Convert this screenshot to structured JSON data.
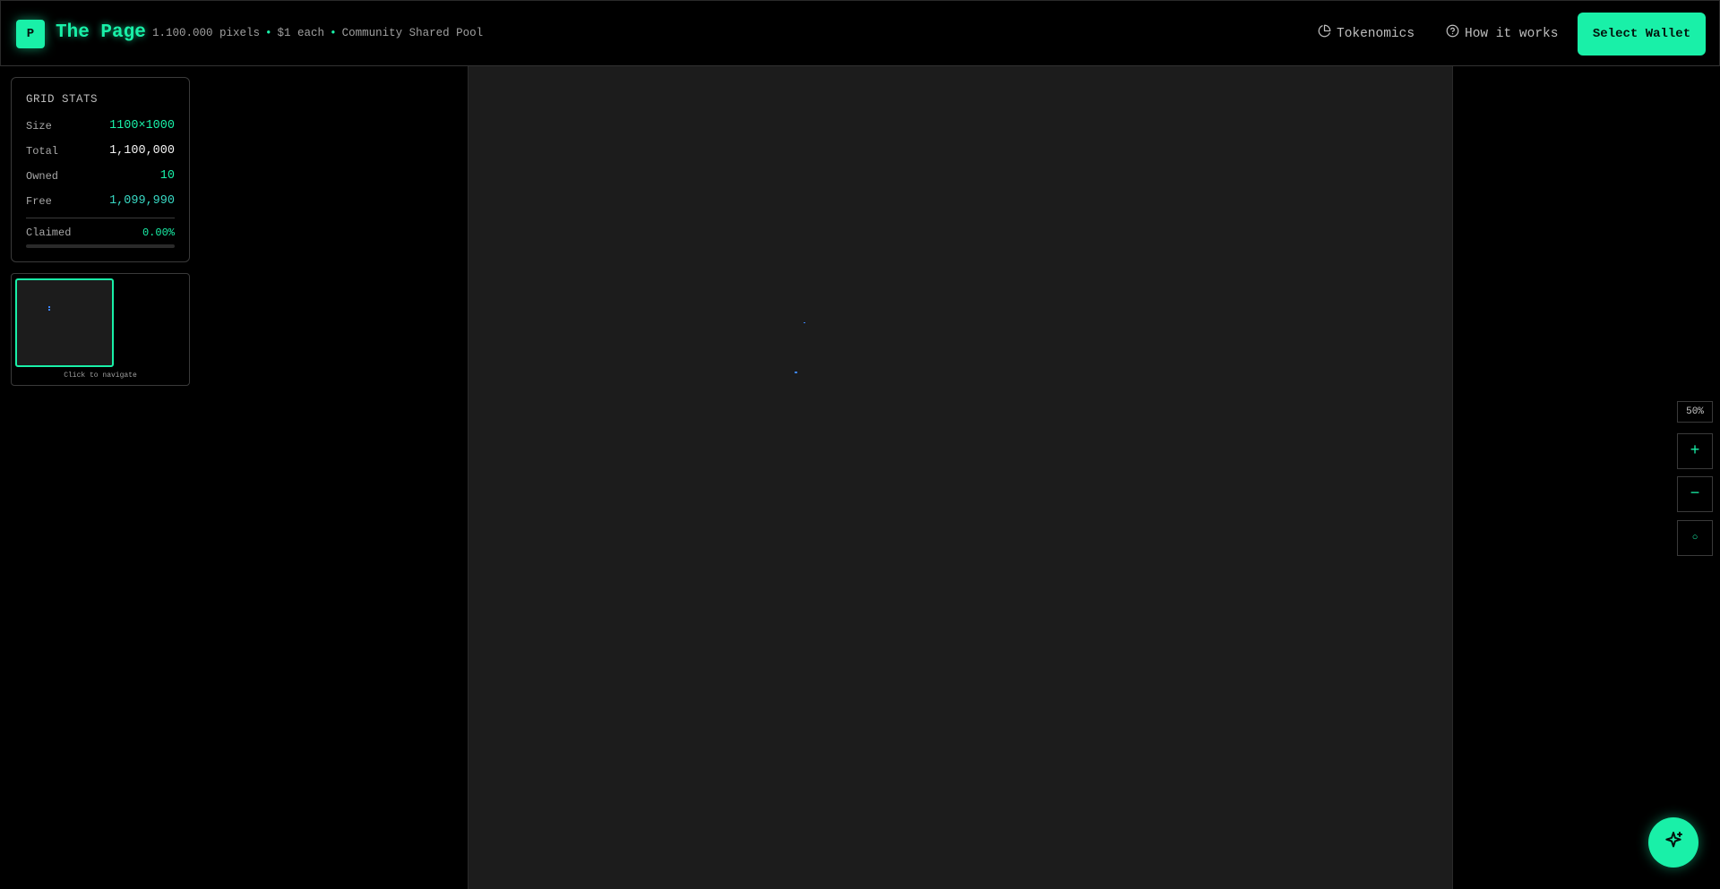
{
  "header": {
    "logo_letter": "P",
    "title": "The Page",
    "tagline_parts": [
      "1.100.000 pixels",
      "$1 each",
      "Community Shared Pool"
    ],
    "tagline_separator": "•",
    "nav": {
      "tokenomics": "Tokenomics",
      "how_it_works": "How it works"
    },
    "wallet_button": "Select Wallet"
  },
  "stats": {
    "title": "GRID STATS",
    "rows": [
      {
        "label": "Size",
        "value": "1100×1000"
      },
      {
        "label": "Total",
        "value": "1,100,000"
      },
      {
        "label": "Owned",
        "value": "10"
      },
      {
        "label": "Free",
        "value": "1,099,990"
      }
    ],
    "claimed_label": "Claimed",
    "claimed_value": "0.00%",
    "claimed_fraction": 0.0
  },
  "minimap": {
    "caption": "Click to navigate"
  },
  "zoom": {
    "level": "50%",
    "in_label": "+",
    "out_label": "−",
    "reset_label": "○"
  },
  "colors": {
    "accent": "#19f0a8",
    "background": "#000000",
    "canvas": "#1c1c1c",
    "owned_pixel": "#3b82f6"
  },
  "icons": {
    "tokenomics": "pie-chart-icon",
    "how_it_works": "help-circle-icon",
    "fab": "sparkles-icon"
  }
}
